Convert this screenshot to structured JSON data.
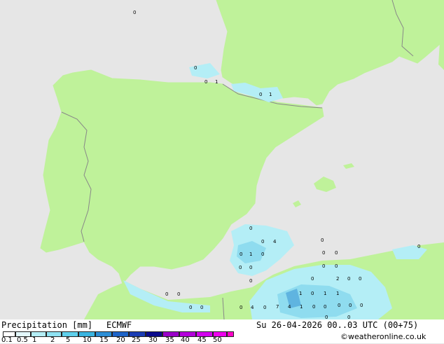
{
  "colors": {
    "land": "#bff29a",
    "sea": "#e6e6e6",
    "border": "#888888",
    "precip_light": "#b4eef6",
    "precip_mid": "#8fdcef",
    "precip_heavy": "#5fb4e0"
  },
  "footer": {
    "product_label": "Precipitation [mm]",
    "model_label": "ECMWF",
    "valid_time": "Su 26-04-2026 00..03 UTC (00+75)",
    "credit": "©weatheronline.co.uk"
  },
  "legend": {
    "ticks": [
      "0.1",
      "0.5",
      "1",
      "2",
      "5",
      "10",
      "15",
      "20",
      "25",
      "30",
      "35",
      "40",
      "45",
      "50"
    ],
    "swatch_colors": [
      "#ffffff",
      "#e3f7fb",
      "#b4eef6",
      "#8fe2f2",
      "#5fd0ec",
      "#3ab4e0",
      "#2b8ed6",
      "#1e64c8",
      "#1a3cb4",
      "#0a0a8c",
      "#9a00c8",
      "#b400dc",
      "#d200ee",
      "#ee00ee",
      "#ff00c8"
    ]
  },
  "map_labels": [
    {
      "text": "0"
    },
    {
      "text": "0"
    },
    {
      "text": "0"
    },
    {
      "text": "1"
    },
    {
      "text": "0"
    },
    {
      "text": "1"
    },
    {
      "text": "0"
    },
    {
      "text": "0"
    },
    {
      "text": "4"
    },
    {
      "text": "0"
    },
    {
      "text": "0"
    },
    {
      "text": "1"
    },
    {
      "text": "0"
    },
    {
      "text": "0"
    },
    {
      "text": "0"
    },
    {
      "text": "0"
    },
    {
      "text": "0"
    },
    {
      "text": "0"
    },
    {
      "text": "0"
    },
    {
      "text": "0"
    },
    {
      "text": "0"
    },
    {
      "text": "0"
    },
    {
      "text": "2"
    },
    {
      "text": "0"
    },
    {
      "text": "0"
    },
    {
      "text": "0"
    },
    {
      "text": "0"
    },
    {
      "text": "1"
    },
    {
      "text": "0"
    },
    {
      "text": "1"
    },
    {
      "text": "1"
    },
    {
      "text": "0"
    },
    {
      "text": "0"
    },
    {
      "text": "0"
    },
    {
      "text": "4"
    },
    {
      "text": "0"
    },
    {
      "text": "7"
    },
    {
      "text": "4"
    },
    {
      "text": "1"
    },
    {
      "text": "0"
    },
    {
      "text": "0"
    },
    {
      "text": "0"
    },
    {
      "text": "0"
    },
    {
      "text": "0"
    },
    {
      "text": "0"
    },
    {
      "text": "0"
    }
  ]
}
